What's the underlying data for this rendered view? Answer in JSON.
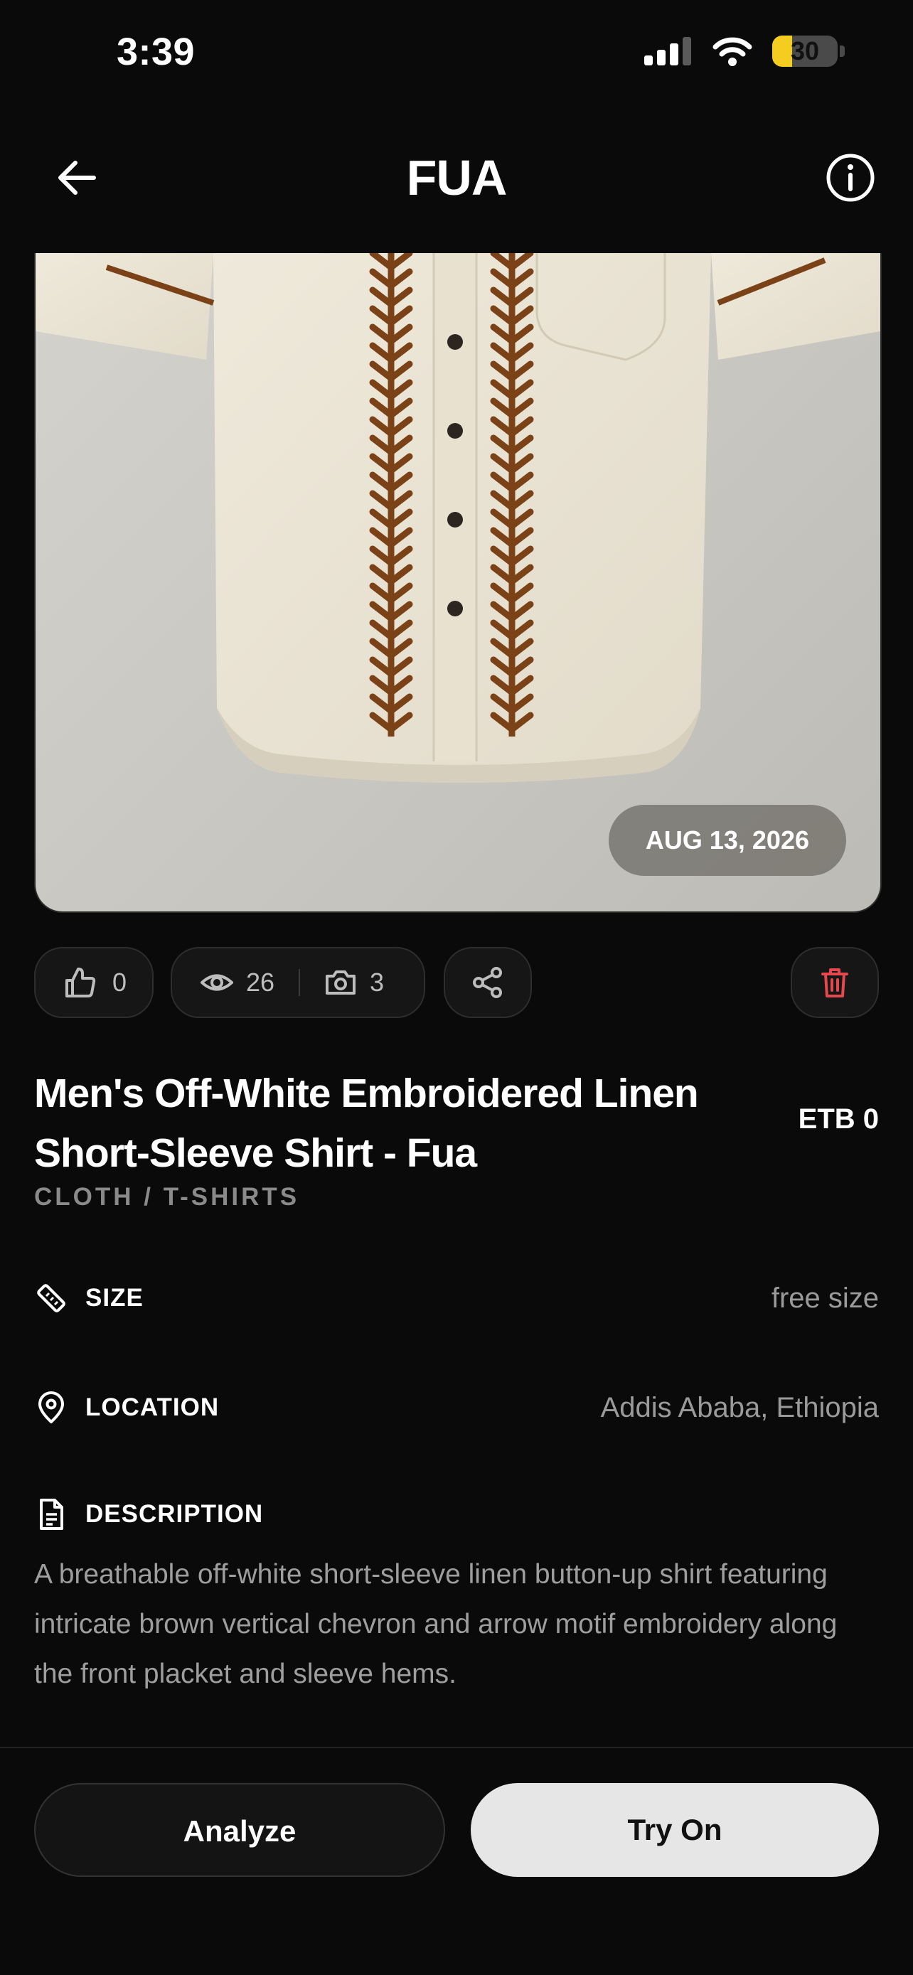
{
  "status_bar": {
    "time": "3:39",
    "battery": "30",
    "battery_level": 0.3
  },
  "header": {
    "title": "FUA"
  },
  "product": {
    "date": "AUG 13, 2026",
    "likes": "0",
    "views": "26",
    "photos": "3",
    "title": "Men's Off-White Embroidered Linen Short-Sleeve Shirt - Fua",
    "price": "ETB 0",
    "category": "CLOTH / T-SHIRTS",
    "size_label": "SIZE",
    "size_value": "free size",
    "location_label": "LOCATION",
    "location_value": "Addis Ababa, Ethiopia",
    "description_label": "DESCRIPTION",
    "description": "A breathable off-white short-sleeve linen button-up shirt featuring intricate brown vertical chevron and arrow motif embroidery along the front placket and sleeve hems."
  },
  "buttons": {
    "analyze": "Analyze",
    "try_on": "Try On"
  },
  "colors": {
    "background": "#0a0a0a",
    "embroidery": "#7a4216",
    "shirt": "#ebe5d6",
    "delete": "#e5484d"
  }
}
